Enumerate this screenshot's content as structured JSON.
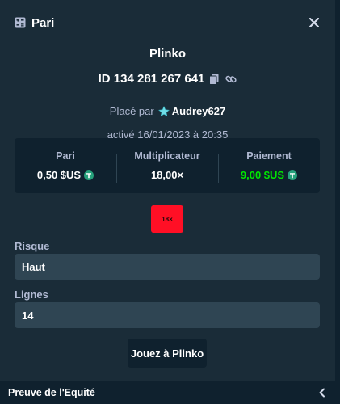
{
  "header": {
    "title": "Pari",
    "icon": "bet-slip-icon",
    "close_icon": "close-icon"
  },
  "bet": {
    "game": "Plinko",
    "id": "ID 134 281 267 641",
    "placed_by_prefix": "Placé par",
    "user": "Audrey627",
    "date": "activé 16/01/2023 à 20:35"
  },
  "stats": {
    "bet_label": "Pari",
    "bet_value": "0,50 $US",
    "multiplier_label": "Multiplicateur",
    "multiplier_value": "18,00×",
    "payout_label": "Paiement",
    "payout_value": "9,00 $US"
  },
  "chip": {
    "label": "18×",
    "color": "#ff0f25"
  },
  "risk": {
    "label": "Risque",
    "value": "Haut"
  },
  "lines": {
    "label": "Lignes",
    "value": "14"
  },
  "play_button": {
    "label": "Jouez à Plinko"
  },
  "footer": {
    "label": "Preuve de l'Equité"
  },
  "colors": {
    "background": "#1a2c38",
    "panel": "#0f212e",
    "input": "#2f4553",
    "win": "#00e701",
    "coin": "#26a17b"
  }
}
